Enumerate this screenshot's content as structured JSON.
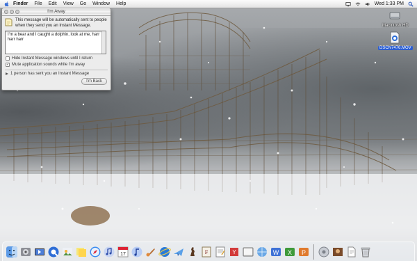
{
  "menubar": {
    "items": [
      "Finder",
      "File",
      "Edit",
      "View",
      "Go",
      "Window",
      "Help"
    ],
    "clock": "Wed 1:33 PM"
  },
  "desktop_icons": [
    {
      "label": "Macintosh HD",
      "icon": "hard-drive-icon"
    },
    {
      "label": "DSCN7476.MOV",
      "icon": "quicktime-movie-icon"
    }
  ],
  "away_window": {
    "title": "I'm Away",
    "info_text": "This message will be automatically sent to people when they send you an Instant Message.",
    "message": "I'm a bear and I caught a dolphin, look at me, harr harr harr",
    "options": [
      {
        "label": "Hide Instant Message windows until I return",
        "checked": false
      },
      {
        "label": "Mute application sounds while I'm away",
        "checked": true
      }
    ],
    "disclosure": "1 person has sent you an Instant Message",
    "button": "I'm Back"
  },
  "dock": {
    "apps": [
      "finder-icon",
      "system-preferences-icon",
      "imovie-icon",
      "quicktime-icon",
      "iphoto-icon",
      "stickies-icon",
      "safari-icon",
      "itunes-icon",
      "ical-icon",
      "mail-icon",
      "garageband-icon",
      "ie-icon",
      "mail2-icon",
      "chess-icon",
      "font-book-icon",
      "terminal-icon",
      "textedit-icon",
      "preview-icon",
      "internet-connect-icon",
      "word-icon",
      "excel-icon",
      "powerpoint-icon"
    ],
    "docs": [
      "downloads-stack-icon",
      "user-folder-icon",
      "document-icon",
      "trash-icon"
    ]
  }
}
